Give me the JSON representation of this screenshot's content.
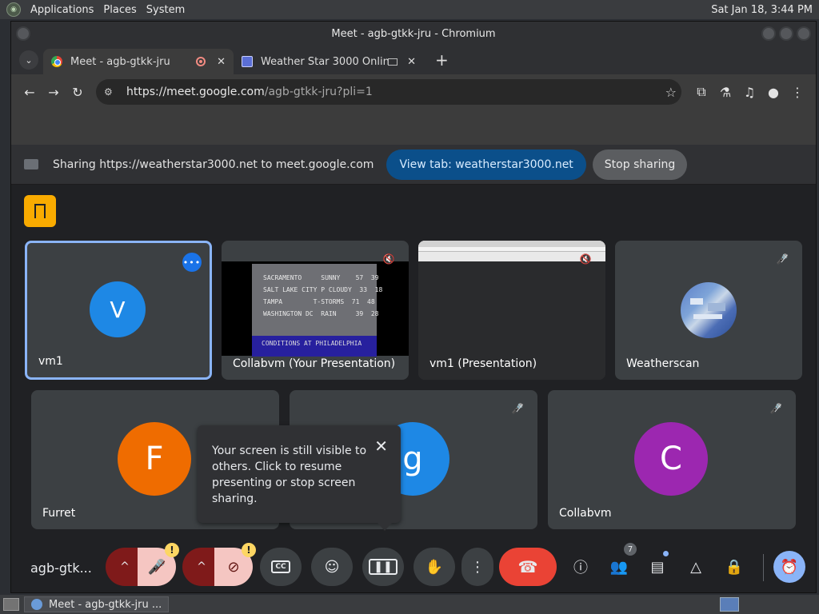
{
  "desktop": {
    "panel_menus": [
      "Applications",
      "Places",
      "System"
    ],
    "clock": "Sat Jan 18,  3:44 PM",
    "taskbar_task": "Meet - agb-gtkk-jru ..."
  },
  "window": {
    "title": "Meet - agb-gtkk-jru - Chromium",
    "tabs": [
      {
        "title": "Meet - agb-gtkk-jru",
        "active": true
      },
      {
        "title": "Weather Star 3000 Onlin",
        "active": false
      }
    ],
    "url_host": "https://meet.google.com",
    "url_path": "/agb-gtkk-jru?pli=1"
  },
  "sharebar": {
    "message": "Sharing https://weatherstar3000.net to meet.google.com",
    "view_tab_label": "View tab: weatherstar3000.net",
    "stop_label": "Stop sharing"
  },
  "tiles": {
    "vm1": {
      "name": "vm1",
      "initial": "V",
      "avatar_color": "#1e88e5"
    },
    "collab_pres": {
      "name": "Collabvm (Your Presentation)"
    },
    "vm1_pres": {
      "name": "vm1 (Presentation)"
    },
    "weatherscan": {
      "name": "Weatherscan"
    },
    "furret": {
      "name": "Furret",
      "initial": "F",
      "avatar_color": "#ef6c00"
    },
    "g": {
      "name": "",
      "initial": "g",
      "avatar_color": "#1e88e5"
    },
    "collabvm": {
      "name": "Collabvm",
      "initial": "C",
      "avatar_color": "#9c27b0"
    }
  },
  "weather_screen": {
    "rows": [
      "SACRAMENTO     SUNNY    57  39",
      "SALT LAKE CITY P CLOUDY  33  18",
      "TAMPA        T-STORMS  71  48",
      "WASHINGTON DC  RAIN     39  28"
    ],
    "ticker": "CONDITIONS AT PHILADELPHIA"
  },
  "tooltip": {
    "text": "Your screen is still visible to others. Click to resume presenting or stop screen sharing."
  },
  "controls": {
    "meeting_code": "agb-gtk...",
    "participant_count": "7",
    "warn_mark": "!"
  },
  "colors": {
    "end_call": "#ea4335",
    "muted_button": "#f5c6c2",
    "muted_button_dark": "#7f1a1a",
    "accent": "#8ab4f8"
  }
}
